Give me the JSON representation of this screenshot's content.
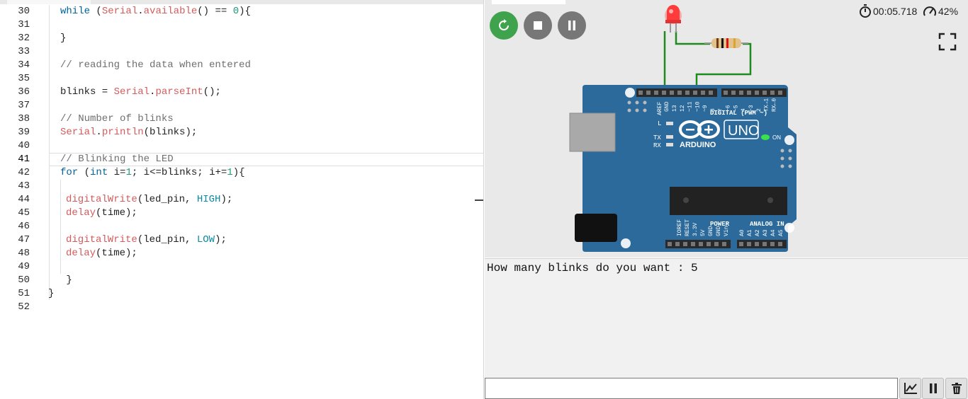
{
  "editor": {
    "lines": [
      {
        "no": "30",
        "parts": [
          {
            "t": "while",
            "c": "kw"
          },
          {
            "t": " ("
          },
          {
            "t": "Serial",
            "c": "cls"
          },
          {
            "t": "."
          },
          {
            "t": "available",
            "c": "cls"
          },
          {
            "t": "() == "
          },
          {
            "t": "0",
            "c": "num"
          },
          {
            "t": "){"
          }
        ],
        "indent": 0
      },
      {
        "no": "31",
        "parts": [],
        "indent": 0
      },
      {
        "no": "32",
        "parts": [
          {
            "t": "}"
          }
        ],
        "indent": 0
      },
      {
        "no": "33",
        "parts": [],
        "indent": 0
      },
      {
        "no": "34",
        "parts": [
          {
            "t": "// reading the data when entered",
            "c": "cm"
          }
        ],
        "indent": 0
      },
      {
        "no": "35",
        "parts": [],
        "indent": 0
      },
      {
        "no": "36",
        "parts": [
          {
            "t": "blinks = "
          },
          {
            "t": "Serial",
            "c": "cls"
          },
          {
            "t": "."
          },
          {
            "t": "parseInt",
            "c": "cls"
          },
          {
            "t": "();"
          }
        ],
        "indent": 0
      },
      {
        "no": "37",
        "parts": [],
        "indent": 0
      },
      {
        "no": "38",
        "parts": [
          {
            "t": "// Number of blinks",
            "c": "cm"
          }
        ],
        "indent": 0
      },
      {
        "no": "39",
        "parts": [
          {
            "t": "Serial",
            "c": "cls"
          },
          {
            "t": "."
          },
          {
            "t": "println",
            "c": "cls"
          },
          {
            "t": "(blinks);"
          }
        ],
        "indent": 0
      },
      {
        "no": "40",
        "parts": [],
        "indent": 0
      },
      {
        "no": "41",
        "parts": [
          {
            "t": "// Blinking the LED",
            "c": "cm"
          }
        ],
        "indent": 0,
        "active": true
      },
      {
        "no": "42",
        "parts": [
          {
            "t": "for",
            "c": "kw"
          },
          {
            "t": " ("
          },
          {
            "t": "int",
            "c": "kw"
          },
          {
            "t": " i="
          },
          {
            "t": "1",
            "c": "num"
          },
          {
            "t": "; i<=blinks; i+="
          },
          {
            "t": "1",
            "c": "num"
          },
          {
            "t": "){"
          }
        ],
        "indent": 0
      },
      {
        "no": "43",
        "parts": [],
        "indent": 1
      },
      {
        "no": "44",
        "parts": [
          {
            "t": "digitalWrite",
            "c": "cls"
          },
          {
            "t": "(led_pin, "
          },
          {
            "t": "HIGH",
            "c": "const"
          },
          {
            "t": ");"
          }
        ],
        "indent": 1
      },
      {
        "no": "45",
        "parts": [
          {
            "t": "delay",
            "c": "cls"
          },
          {
            "t": "(time);"
          }
        ],
        "indent": 1
      },
      {
        "no": "46",
        "parts": [],
        "indent": 1
      },
      {
        "no": "47",
        "parts": [
          {
            "t": "digitalWrite",
            "c": "cls"
          },
          {
            "t": "(led_pin, "
          },
          {
            "t": "LOW",
            "c": "const"
          },
          {
            "t": ");"
          }
        ],
        "indent": 1
      },
      {
        "no": "48",
        "parts": [
          {
            "t": "delay",
            "c": "cls"
          },
          {
            "t": "(time);"
          }
        ],
        "indent": 1
      },
      {
        "no": "49",
        "parts": [],
        "indent": 1
      },
      {
        "no": "50",
        "parts": [
          {
            "t": " }"
          }
        ],
        "indent": 0
      },
      {
        "no": "51",
        "parts": [
          {
            "t": "}"
          }
        ],
        "indent": -1
      },
      {
        "no": "52",
        "parts": [],
        "indent": 0
      }
    ]
  },
  "simulator": {
    "controls": [
      {
        "name": "restart",
        "icon": "restart-icon",
        "color": "#3fa34d"
      },
      {
        "name": "stop",
        "icon": "stop-icon",
        "color": "#777777"
      },
      {
        "name": "pause",
        "icon": "pause-icon",
        "color": "#777777"
      }
    ],
    "timer": "00:05.718",
    "speed": "42%",
    "fullscreen_icon": "fullscreen-icon",
    "board": {
      "brand": "ARDUINO",
      "model": "UNO",
      "on_label": "ON",
      "digital_label": "DIGITAL (PWM ~)",
      "power_label": "POWER",
      "analog_label": "ANALOG IN",
      "l_label": "L",
      "tx_label": "TX",
      "rx_label": "RX",
      "aref_label": "AREF",
      "gnd_label": "GND",
      "digital_pins": [
        "13",
        "12",
        "~11",
        "~10",
        "~9",
        "8",
        "7",
        "~6",
        "~5",
        "4",
        "~3",
        "2",
        "TX→1",
        "RX←0"
      ],
      "power_pins": [
        "IOREF",
        "RESET",
        "3.3V",
        "5V",
        "GND",
        "GND",
        "Vin"
      ],
      "analog_pins": [
        "A0",
        "A1",
        "A2",
        "A3",
        "A4",
        "A5"
      ]
    },
    "colors": {
      "board": "#2b6a9b",
      "led": "#ff3b3b",
      "wire": "#1f8a1f",
      "on_led": "#39e14a"
    }
  },
  "serial": {
    "output": "How many blinks do you want : 5",
    "input_value": "",
    "buttons": [
      {
        "name": "plotter-button",
        "icon": "chart-icon"
      },
      {
        "name": "pause-serial-button",
        "icon": "pause-icon"
      },
      {
        "name": "clear-serial-button",
        "icon": "trash-icon"
      }
    ]
  }
}
